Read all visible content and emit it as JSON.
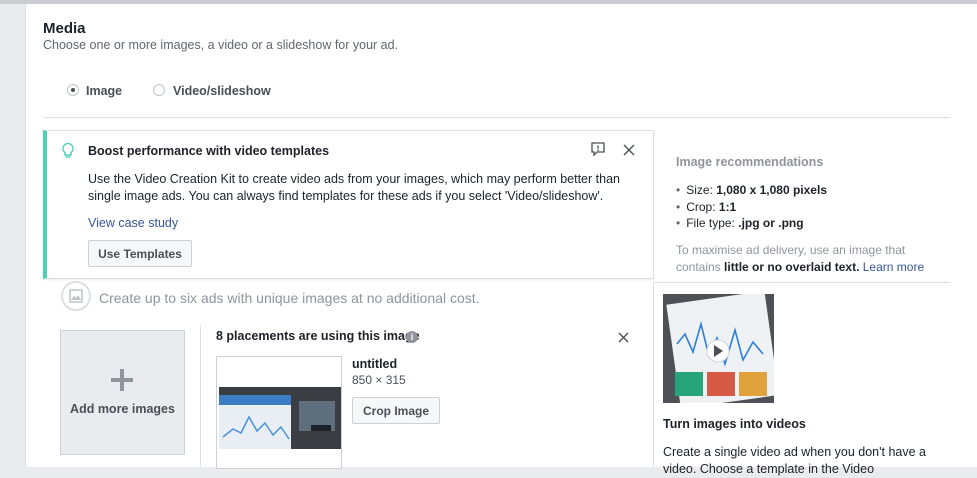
{
  "section": {
    "title": "Media",
    "subtitle": "Choose one or more images, a video or a slideshow for your ad."
  },
  "format_options": [
    {
      "label": "Image",
      "selected": true
    },
    {
      "label": "Video/slideshow",
      "selected": false
    }
  ],
  "notice": {
    "title": "Boost performance with video templates",
    "body": "Use the Video Creation Kit to create video ads from your images, which may perform better than single image ads. You can always find templates for these ads if you select 'Video/slideshow'.",
    "link": "View case study",
    "button": "Use Templates",
    "accent_color": "#4dd0b6"
  },
  "recommendations": {
    "title": "Image recommendations",
    "items": [
      {
        "label": "Size:",
        "value": "1,080 x 1,080 pixels"
      },
      {
        "label": "Crop:",
        "value": "1:1"
      },
      {
        "label": "File type:",
        "value": ".jpg or .png"
      }
    ],
    "note_prefix": "To maximise ad delivery, use an image that contains",
    "note_bold": "little or no overlaid text.",
    "note_link": "Learn more"
  },
  "multi_ads_hint": "Create up to six ads with unique images at no additional cost.",
  "add_images_label": "Add more images",
  "placements": {
    "text": "8 placements are using this image",
    "file_name": "untitled",
    "dimensions": "850 × 315",
    "crop_button": "Crop Image"
  },
  "video_promo": {
    "title": "Turn images into videos",
    "body": "Create a single video ad when you don't have a video. Choose a template in the Video"
  },
  "colors": {
    "link": "#365899",
    "muted": "#90949c",
    "border": "#dddfe2"
  }
}
